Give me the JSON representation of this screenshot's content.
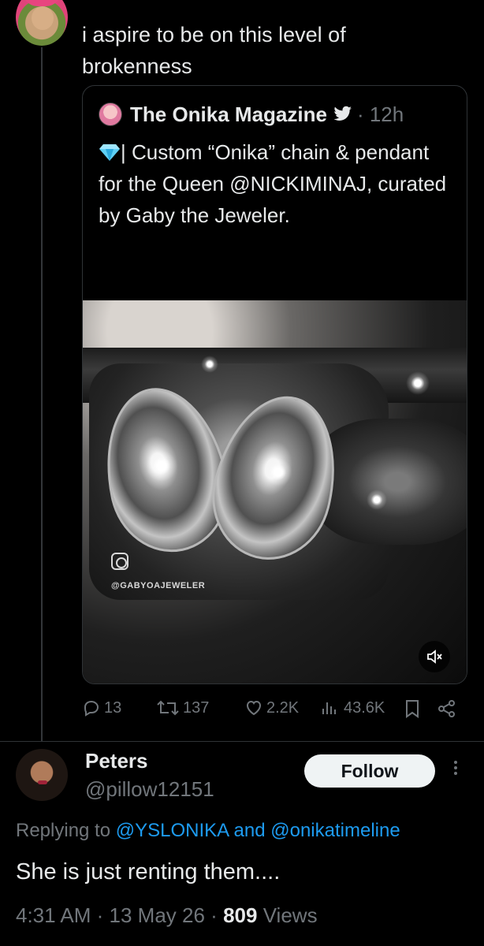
{
  "parent_tweet": {
    "text": "i aspire to be on this level of brokenness"
  },
  "quote": {
    "author_name": "The Onika Magazine",
    "time": "· 12h",
    "body": "| Custom “Onika” chain & pendant for the Queen @NICKIMINAJ, curated by Gaby the Jeweler.",
    "more": "...",
    "media_watermark": "@GABYOAJEWELER",
    "verified_icon": "bird-icon",
    "gem_icon": "gem-icon"
  },
  "actions": {
    "replies": "13",
    "retweets": "137",
    "likes": "2.2K",
    "views": "43.6K"
  },
  "reply": {
    "name": "Peters",
    "handle": "@pillow12151",
    "follow_label": "Follow",
    "replying_prefix": "Replying to",
    "replying_to_1": "@YSLONIKA",
    "replying_and": "and",
    "replying_to_2": "@onikatimeline",
    "text": "She is just renting them....",
    "time": "4:31 AM",
    "date": "13 May 26",
    "views_count": "809",
    "views_label": "Views"
  },
  "colors": {
    "background": "#000000",
    "text": "#e7e9ea",
    "muted": "#71767b",
    "link": "#1d9bf0",
    "border": "#2f3336"
  }
}
